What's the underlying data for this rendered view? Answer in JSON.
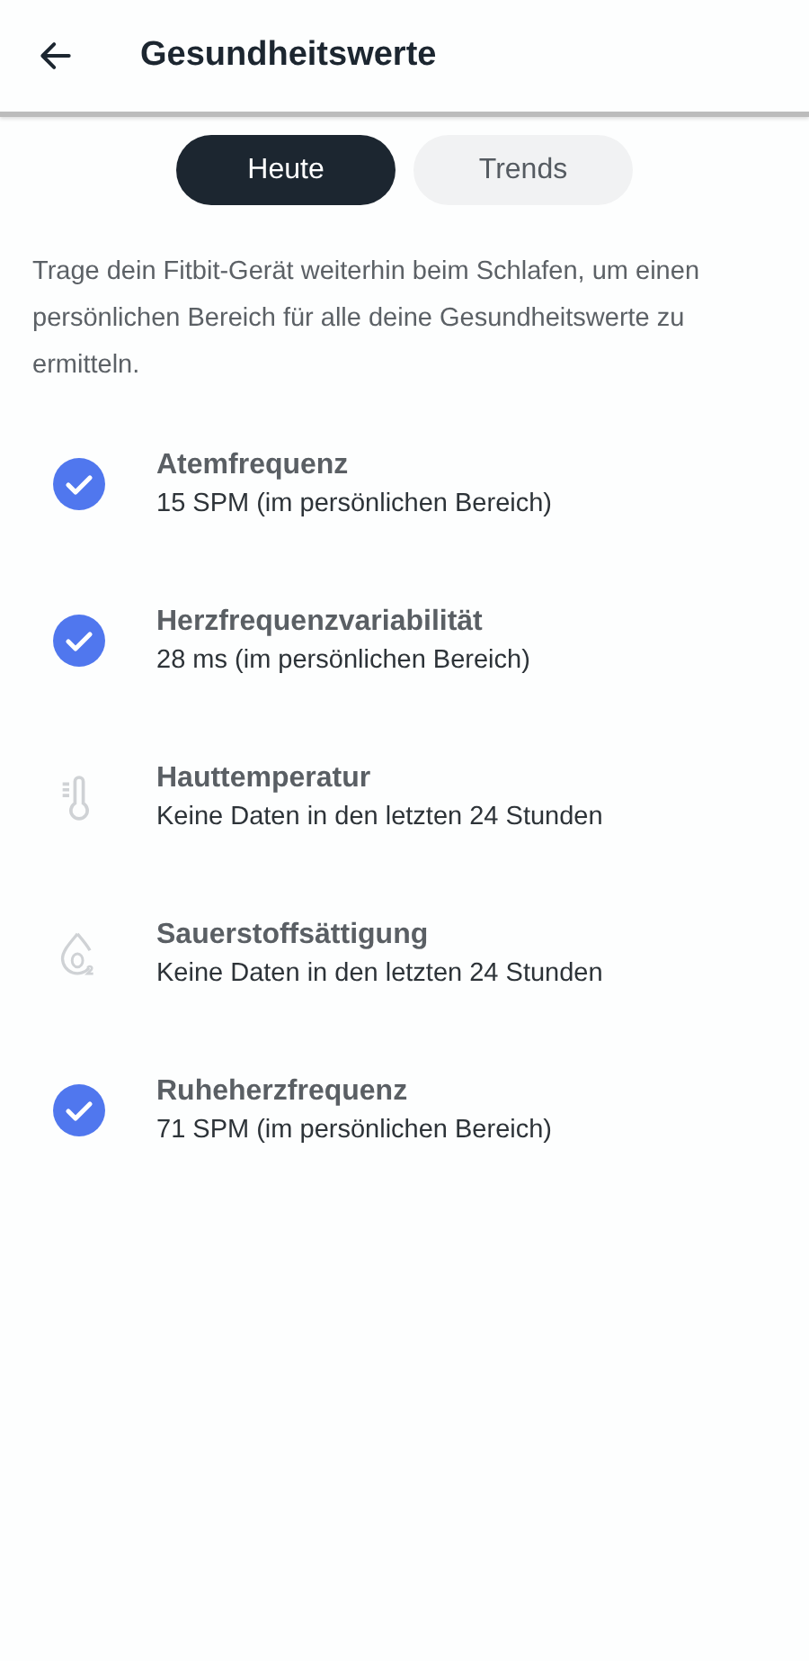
{
  "header": {
    "title": "Gesundheitswerte"
  },
  "tabs": [
    {
      "label": "Heute",
      "selected": true
    },
    {
      "label": "Trends",
      "selected": false
    }
  ],
  "intro": "Trage dein Fitbit-Gerät weiterhin beim Schlafen, um einen persönlichen Bereich für alle deine Gesundheitswerte zu ermitteln.",
  "metrics": [
    {
      "kind": "check",
      "name": "Atemfrequenz",
      "value": "15 SPM (im persönlichen Bereich)"
    },
    {
      "kind": "check",
      "name": "Herzfrequenzvariabilität",
      "value": "28 ms (im persönlichen Bereich)"
    },
    {
      "kind": "thermometer",
      "name": "Hauttemperatur",
      "value": "Keine Daten in den letzten 24 Stunden"
    },
    {
      "kind": "oxygen",
      "name": "Sauerstoffsättigung",
      "value": "Keine Daten in den letzten 24 Stunden"
    },
    {
      "kind": "check",
      "name": "Ruheherzfrequenz",
      "value": "71 SPM (im persönlichen Bereich)"
    }
  ]
}
